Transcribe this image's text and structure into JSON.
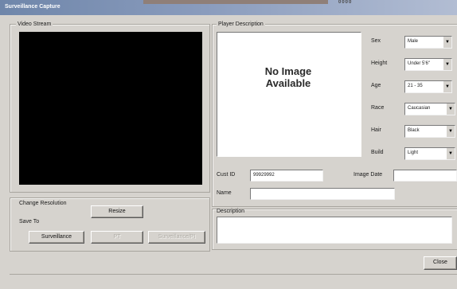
{
  "window": {
    "title": "Surveillance Capture",
    "top_digits": "0000"
  },
  "video": {
    "group_label": "Video Stream"
  },
  "resolution": {
    "change_label": "Change Resolution",
    "resize_button": "Resize",
    "save_to_label": "Save To",
    "buttons": [
      {
        "label": "Surveillance",
        "enabled": true
      },
      {
        "label": "PT",
        "enabled": false
      },
      {
        "label": "Surveillance/PI",
        "enabled": false
      }
    ]
  },
  "player": {
    "group_label": "Player Description",
    "no_image_line1": "No Image",
    "no_image_line2": "Available",
    "attributes": [
      {
        "label": "Sex",
        "value": "Male"
      },
      {
        "label": "Height",
        "value": "Under 5'6\""
      },
      {
        "label": "Age",
        "value": "21 - 35"
      },
      {
        "label": "Race",
        "value": "Caucasian"
      },
      {
        "label": "Hair",
        "value": "Black"
      },
      {
        "label": "Build",
        "value": "Light"
      }
    ],
    "cust_id_label": "Cust ID",
    "cust_id_value": "99929992",
    "image_date_label": "Image Date",
    "image_date_value": "",
    "name_label": "Name",
    "name_value": ""
  },
  "description": {
    "label": "Description",
    "value": ""
  },
  "actions": {
    "close_button": "Close"
  }
}
